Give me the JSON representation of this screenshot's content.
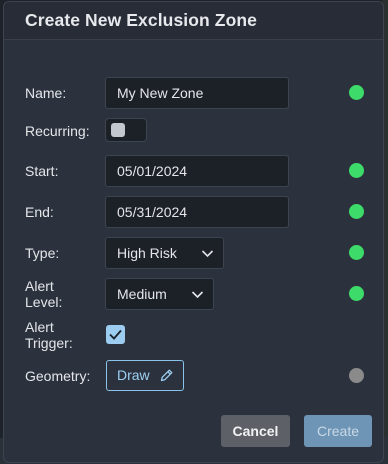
{
  "dialog": {
    "title": "Create New Exclusion Zone"
  },
  "form": {
    "name": {
      "label": "Name:",
      "value": "My New Zone",
      "status_color": "#3ddc6a"
    },
    "recurring": {
      "label": "Recurring:",
      "checked": false
    },
    "start": {
      "label": "Start:",
      "value": "05/01/2024",
      "status_color": "#3ddc6a"
    },
    "end": {
      "label": "End:",
      "value": "05/31/2024",
      "status_color": "#3ddc6a"
    },
    "type": {
      "label": "Type:",
      "value": "High Risk",
      "status_color": "#3ddc6a"
    },
    "alert_level": {
      "label_line1": "Alert",
      "label_line2": "Level:",
      "value": "Medium",
      "status_color": "#3ddc6a"
    },
    "alert_trigger": {
      "label_line1": "Alert",
      "label_line2": "Trigger:",
      "checked": true
    },
    "geometry": {
      "label": "Geometry:",
      "button_label": "Draw",
      "button_icon": "pencil-icon",
      "status_color": "#8a8a8a"
    }
  },
  "footer": {
    "cancel_label": "Cancel",
    "create_label": "Create"
  },
  "colors": {
    "accent": "#9ccdf0",
    "valid": "#3ddc6a",
    "pending": "#8a8a8a"
  }
}
